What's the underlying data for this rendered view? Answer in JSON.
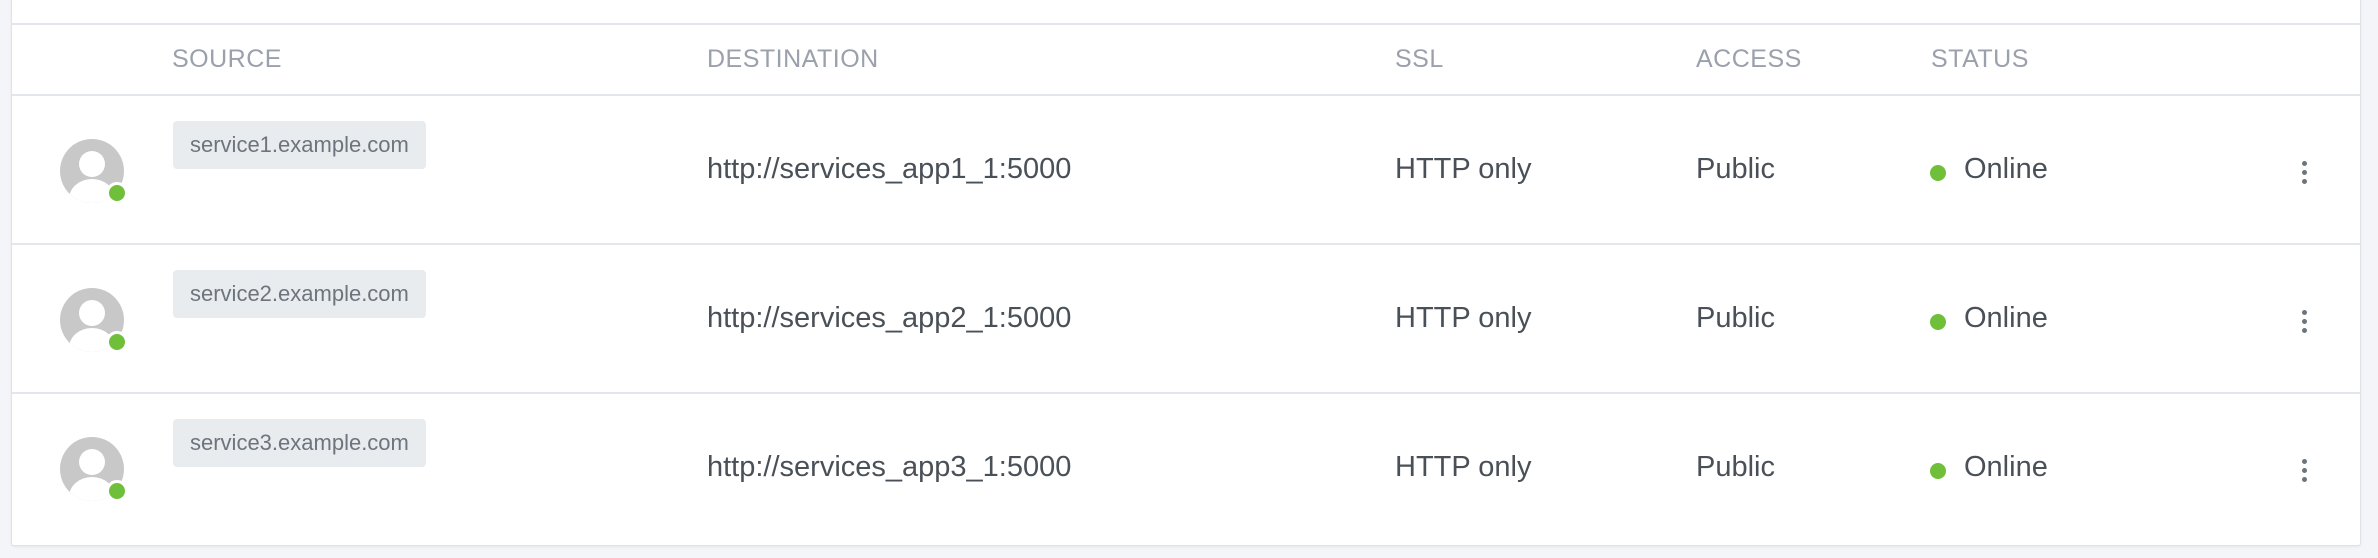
{
  "table": {
    "columns": {
      "source": "SOURCE",
      "destination": "DESTINATION",
      "ssl": "SSL",
      "access": "ACCESS",
      "status": "STATUS"
    },
    "rows": [
      {
        "source": "service1.example.com",
        "destination": "http://services_app1_1:5000",
        "ssl": "HTTP only",
        "access": "Public",
        "status": "Online"
      },
      {
        "source": "service2.example.com",
        "destination": "http://services_app2_1:5000",
        "ssl": "HTTP only",
        "access": "Public",
        "status": "Online"
      },
      {
        "source": "service3.example.com",
        "destination": "http://services_app3_1:5000",
        "ssl": "HTTP only",
        "access": "Public",
        "status": "Online"
      }
    ]
  },
  "icons": {
    "avatar": "user-avatar-icon",
    "online_indicator": "online-dot-icon",
    "status_dot": "status-dot-icon",
    "row_menu": "kebab-menu-icon"
  },
  "colors": {
    "online": "#6fbf3b",
    "header_text": "#9aa0ac",
    "body_text": "#495057",
    "badge_bg": "#e9ecef"
  }
}
